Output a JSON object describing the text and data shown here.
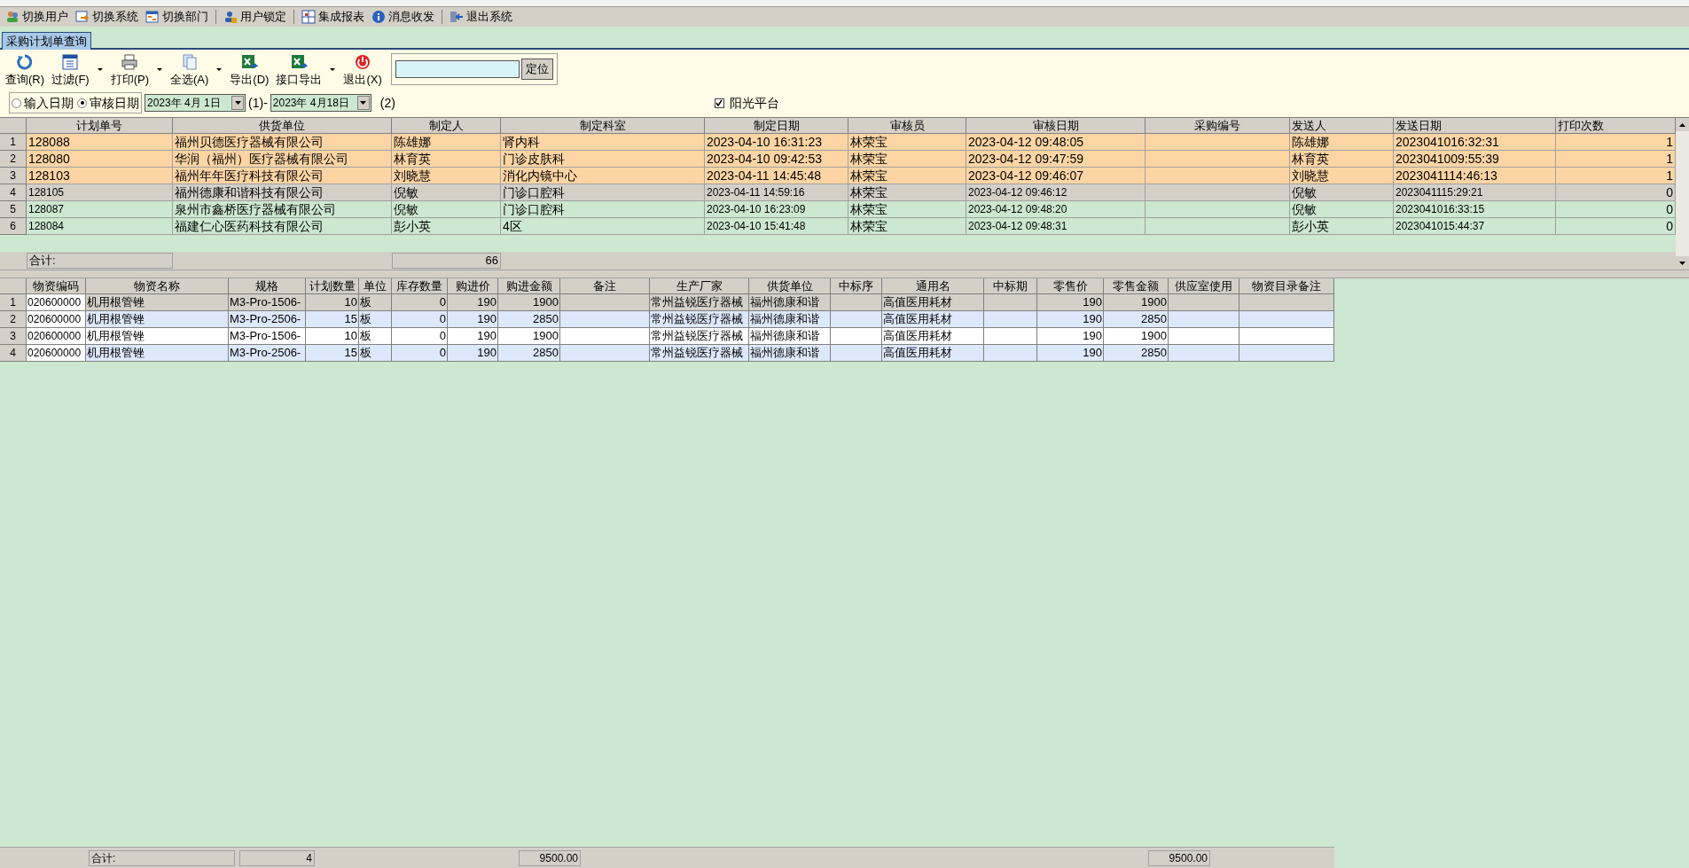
{
  "quick_toolbar": [
    {
      "label": "切换用户"
    },
    {
      "label": "切换系统"
    },
    {
      "label": "切换部门"
    },
    {
      "label": "用户锁定"
    },
    {
      "label": "集成报表"
    },
    {
      "label": "消息收发"
    },
    {
      "label": "退出系统"
    }
  ],
  "tabs": [
    {
      "label": "采购计划单查询",
      "selected": true
    }
  ],
  "toolbar": [
    {
      "label": "查询(R)",
      "dropdown": false
    },
    {
      "label": "过滤(F)",
      "dropdown": true
    },
    {
      "label": "打印(P)",
      "dropdown": true
    },
    {
      "label": "全选(A)",
      "dropdown": true
    },
    {
      "label": "导出(D)",
      "dropdown": false
    },
    {
      "label": "接口导出",
      "dropdown": true
    },
    {
      "label": "退出(X)",
      "dropdown": false
    }
  ],
  "locate": {
    "button": "定位"
  },
  "date_filter": {
    "options": [
      {
        "label": "输入日期",
        "selected": false
      },
      {
        "label": "审核日期",
        "selected": true
      }
    ],
    "from": "2023年 4月 1日",
    "from_hint": "(1)",
    "separator": "-",
    "to": "2023年 4月18日",
    "to_hint": "(2)"
  },
  "sunshine": {
    "label": "阳光平台",
    "checked": true
  },
  "plans": {
    "columns": [
      "计划单号",
      "供货单位",
      "制定人",
      "制定科室",
      "制定日期",
      "审核员",
      "审核日期",
      "采购编号",
      "发送人",
      "发送日期",
      "打印次数"
    ],
    "rows": [
      {
        "no": "1",
        "highlight": true,
        "selected": false,
        "cells": [
          "128088",
          "福州贝德医疗器械有限公司",
          "陈雄娜",
          "肾内科",
          "2023-04-10 16:31:23",
          "林荣宝",
          "2023-04-12 09:48:05",
          "",
          "陈雄娜",
          "2023041016:32:31",
          "1"
        ]
      },
      {
        "no": "2",
        "highlight": true,
        "selected": false,
        "cells": [
          "128080",
          "华润（福州）医疗器械有限公司",
          "林育英",
          "门诊皮肤科",
          "2023-04-10 09:42:53",
          "林荣宝",
          "2023-04-12 09:47:59",
          "",
          "林育英",
          "2023041009:55:39",
          "1"
        ]
      },
      {
        "no": "3",
        "highlight": true,
        "selected": false,
        "cells": [
          "128103",
          "福州年年医疗科技有限公司",
          "刘晓慧",
          "消化内镜中心",
          "2023-04-11 14:45:48",
          "林荣宝",
          "2023-04-12 09:46:07",
          "",
          "刘晓慧",
          "2023041114:46:13",
          "1"
        ]
      },
      {
        "no": "4",
        "highlight": false,
        "selected": true,
        "cells": [
          "128105",
          "福州德康和谐科技有限公司",
          "倪敏",
          "门诊口腔科",
          "2023-04-11 14:59:16",
          "林荣宝",
          "2023-04-12 09:46:12",
          "",
          "倪敏",
          "2023041115:29:21",
          "0"
        ]
      },
      {
        "no": "5",
        "highlight": false,
        "selected": false,
        "cells": [
          "128087",
          "泉州市鑫桥医疗器械有限公司",
          "倪敏",
          "门诊口腔科",
          "2023-04-10 16:23:09",
          "林荣宝",
          "2023-04-12 09:48:20",
          "",
          "倪敏",
          "2023041016:33:15",
          "0"
        ]
      },
      {
        "no": "6",
        "highlight": false,
        "selected": false,
        "cells": [
          "128084",
          "福建仁心医药科技有限公司",
          "彭小英",
          "4区",
          "2023-04-10 15:41:48",
          "林荣宝",
          "2023-04-12 09:48:31",
          "",
          "彭小英",
          "2023041015:44:37",
          "0"
        ]
      }
    ],
    "summary": {
      "label": "合计:",
      "count": "66"
    }
  },
  "items": {
    "columns": [
      "物资编码",
      "物资名称",
      "规格",
      "计划数量",
      "单位",
      "库存数量",
      "购进价",
      "购进金额",
      "备注",
      "生产厂家",
      "供货单位",
      "中标序",
      "通用名",
      "中标期",
      "零售价",
      "零售金额",
      "供应室使用",
      "物资目录备注"
    ],
    "rows": [
      {
        "no": "1",
        "selected": true,
        "cells": [
          "020600000",
          "机用根管锉",
          "M3-Pro-1506-",
          "10",
          "板",
          "0",
          "190",
          "1900",
          "",
          "常州益锐医疗器械",
          "福州德康和谐",
          "",
          "高值医用耗材",
          "",
          "190",
          "1900",
          "",
          ""
        ]
      },
      {
        "no": "2",
        "selected": false,
        "cells": [
          "020600000",
          "机用根管锉",
          "M3-Pro-2506-",
          "15",
          "板",
          "0",
          "190",
          "2850",
          "",
          "常州益锐医疗器械",
          "福州德康和谐",
          "",
          "高值医用耗材",
          "",
          "190",
          "2850",
          "",
          ""
        ]
      },
      {
        "no": "3",
        "selected": false,
        "cells": [
          "020600000",
          "机用根管锉",
          "M3-Pro-1506-",
          "10",
          "板",
          "0",
          "190",
          "1900",
          "",
          "常州益锐医疗器械",
          "福州德康和谐",
          "",
          "高值医用耗材",
          "",
          "190",
          "1900",
          "",
          ""
        ]
      },
      {
        "no": "4",
        "selected": false,
        "cells": [
          "020600000",
          "机用根管锉",
          "M3-Pro-2506-",
          "15",
          "板",
          "0",
          "190",
          "2850",
          "",
          "常州益锐医疗器械",
          "福州德康和谐",
          "",
          "高值医用耗材",
          "",
          "190",
          "2850",
          "",
          ""
        ]
      }
    ],
    "summary": {
      "label": "合计:",
      "count": "4",
      "amount": "9500.00",
      "retail_amount": "9500.00"
    }
  }
}
